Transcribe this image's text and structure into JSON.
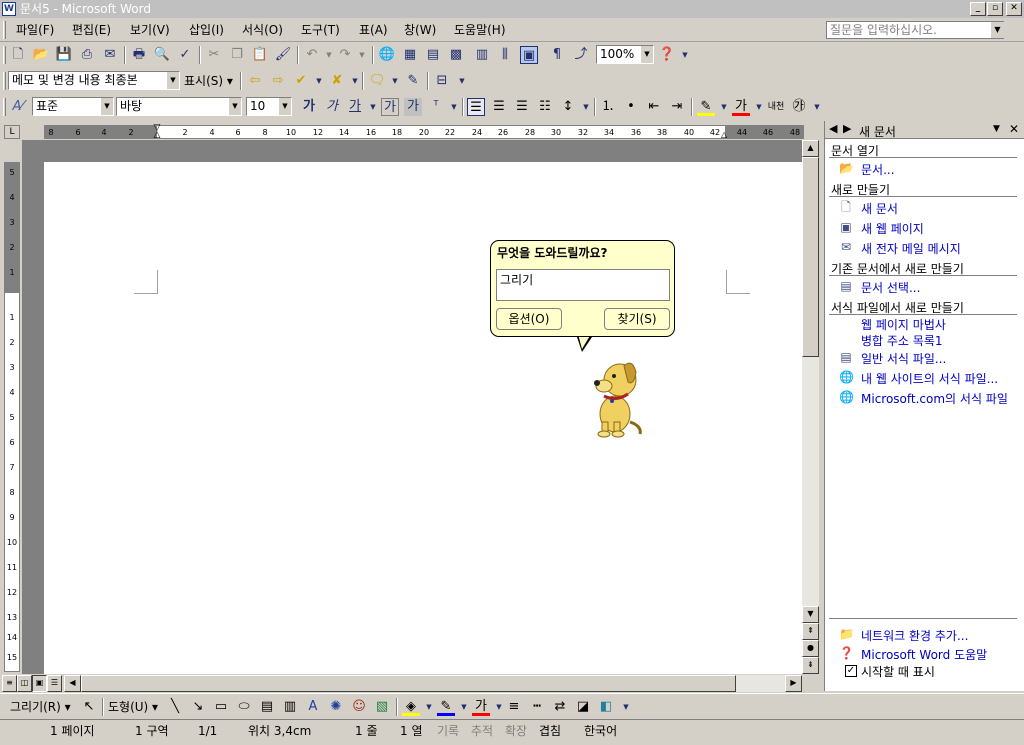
{
  "window": {
    "title": "문서5 - Microsoft Word"
  },
  "menubar": {
    "items": [
      "파일(F)",
      "편집(E)",
      "보기(V)",
      "삽입(I)",
      "서식(O)",
      "도구(T)",
      "표(A)",
      "창(W)",
      "도움말(H)"
    ],
    "ask_placeholder": "질문을 입력하십시오."
  },
  "standard_toolbar": {
    "zoom": "100%"
  },
  "reviewing_toolbar": {
    "display_mode": "메모 및 변경 내용 최종본",
    "show_label": "표시(S)"
  },
  "formatting_toolbar": {
    "style": "표준",
    "font": "바탕",
    "size": "10"
  },
  "ruler": {
    "h_ticks": [
      "8",
      "6",
      "4",
      "2",
      "2",
      "4",
      "6",
      "8",
      "10",
      "12",
      "14",
      "16",
      "18",
      "20",
      "22",
      "24",
      "26",
      "28",
      "30",
      "32",
      "34",
      "36",
      "38",
      "40",
      "42",
      "44",
      "46",
      "48"
    ],
    "v_ticks": [
      "5",
      "4",
      "3",
      "2",
      "1",
      "1",
      "2",
      "3",
      "4",
      "5",
      "6",
      "7",
      "8",
      "9",
      "10",
      "11",
      "12",
      "13",
      "14",
      "15"
    ]
  },
  "assistant": {
    "question": "무엇을 도와드릴까요?",
    "query": "그리기",
    "options_button": "옵션(O)",
    "search_button": "찾기(S)"
  },
  "task_pane": {
    "title": "새 문서",
    "open_section": "문서 열기",
    "open_items": [
      "문서..."
    ],
    "new_section": "새로 만들기",
    "new_items": [
      "새 문서",
      "새 웹 페이지",
      "새 전자 메일 메시지"
    ],
    "existing_section": "기존 문서에서 새로 만들기",
    "existing_items": [
      "문서 선택..."
    ],
    "template_section": "서식 파일에서 새로 만들기",
    "template_items": [
      "웹 페이지 마법사",
      "병합 주소 목록1",
      "일반 서식 파일...",
      "내 웹 사이트의 서식 파일...",
      "Microsoft.com의 서식 파일"
    ],
    "bottom_items": [
      "네트워크 환경 추가...",
      "Microsoft Word 도움말"
    ],
    "show_at_startup": "시작할 때 표시"
  },
  "drawing_toolbar": {
    "draw_label": "그리기(R)",
    "autoshapes_label": "도형(U)"
  },
  "statusbar": {
    "page": "1 페이지",
    "section": "1 구역",
    "page_of": "1/1",
    "position": "위치 3,4cm",
    "line": "1 줄",
    "column": "1 열",
    "rec": "기록",
    "trk": "추적",
    "ext": "확장",
    "ovr": "겹침",
    "language": "한국어"
  }
}
